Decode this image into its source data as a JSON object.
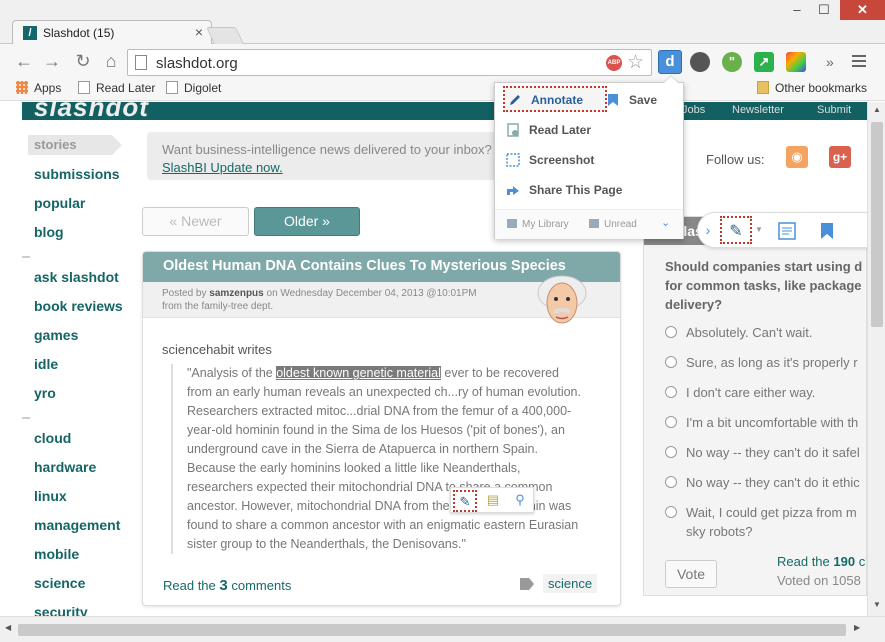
{
  "browser": {
    "tab_title": "Slashdot (15)",
    "url": "slashdot.org",
    "bookmarks": [
      "Apps",
      "Read Later",
      "Digolet"
    ],
    "other_bookmarks": "Other bookmarks"
  },
  "extensions": {
    "abp_label": "ABP",
    "diigo_letter": "d"
  },
  "popup": {
    "annotate": "Annotate",
    "save": "Save",
    "read_later": "Read Later",
    "screenshot": "Screenshot",
    "share": "Share This Page",
    "my_library": "My Library",
    "unread": "Unread"
  },
  "sidebar": {
    "stories": "stories",
    "group1": [
      "submissions",
      "popular",
      "blog"
    ],
    "group2": [
      "ask slashdot",
      "book reviews",
      "games",
      "idle",
      "yro"
    ],
    "group3": [
      "cloud",
      "hardware",
      "linux",
      "management",
      "mobile",
      "science",
      "security"
    ]
  },
  "promo": {
    "text": "Want business-intelligence news delivered to your inbox?",
    "link": "SlashBI Update now."
  },
  "pager": {
    "newer": "« Newer",
    "older": "Older »"
  },
  "article": {
    "title": "Oldest Human DNA Contains Clues To Mysterious Species",
    "posted_by_prefix": "Posted by",
    "author": "samzenpus",
    "posted_on": "on Wednesday December 04, 2013 @10:01PM",
    "dept": "from the family-tree dept.",
    "writer": "sciencehabit writes",
    "quote_start": "\"Analysis of the ",
    "quote_highlight": "oldest known genetic material",
    "quote_rest": " ever to be recovered from an early human reveals an unexpected ch...ry of human evolution. Researchers extracted mitoc...drial DNA from the femur of a 400,000-year-old hominin found in the Sima de los Huesos ('pit of bones'), an underground cave in the Sierra de Atapuerca in northern Spain. Because the early hominins looked a little like Neanderthals, researchers expected their mitochondrial DNA to share a common ancestor. However, mitochondrial DNA from the Spanish hominin was found to share a common ancestor with an enigmatic eastern Eurasian sister group to the Neanderthals, the Denisovans.\"",
    "read_prefix": "Read the",
    "comments_count": "3",
    "read_suffix": "comments",
    "tag": "science"
  },
  "right": {
    "follow": "Follow us:",
    "rss": "RSS",
    "gplus": "g+"
  },
  "poll": {
    "header": "Slashdot Poll",
    "question_lines": [
      "Should companies start using d",
      "for common tasks, like package",
      "delivery?"
    ],
    "options": [
      "Absolutely. Can't wait.",
      "Sure, as long as it's properly r",
      "I don't care either way.",
      "I'm a bit uncomfortable with th",
      "No way -- they can't do it safel",
      "No way -- they can't do it ethic",
      "Wait, I could get pizza from m"
    ],
    "option7_line2": "sky robots?",
    "vote": "Vote",
    "read_prefix": "Read the",
    "read_count": "190",
    "read_suffix": "c",
    "voted": "Voted on 1058"
  },
  "colors": {
    "brand_teal": "#126062",
    "link_teal": "#16696a",
    "title_bar": "#7fa8a8",
    "annotate_outline": "#c0392b"
  }
}
